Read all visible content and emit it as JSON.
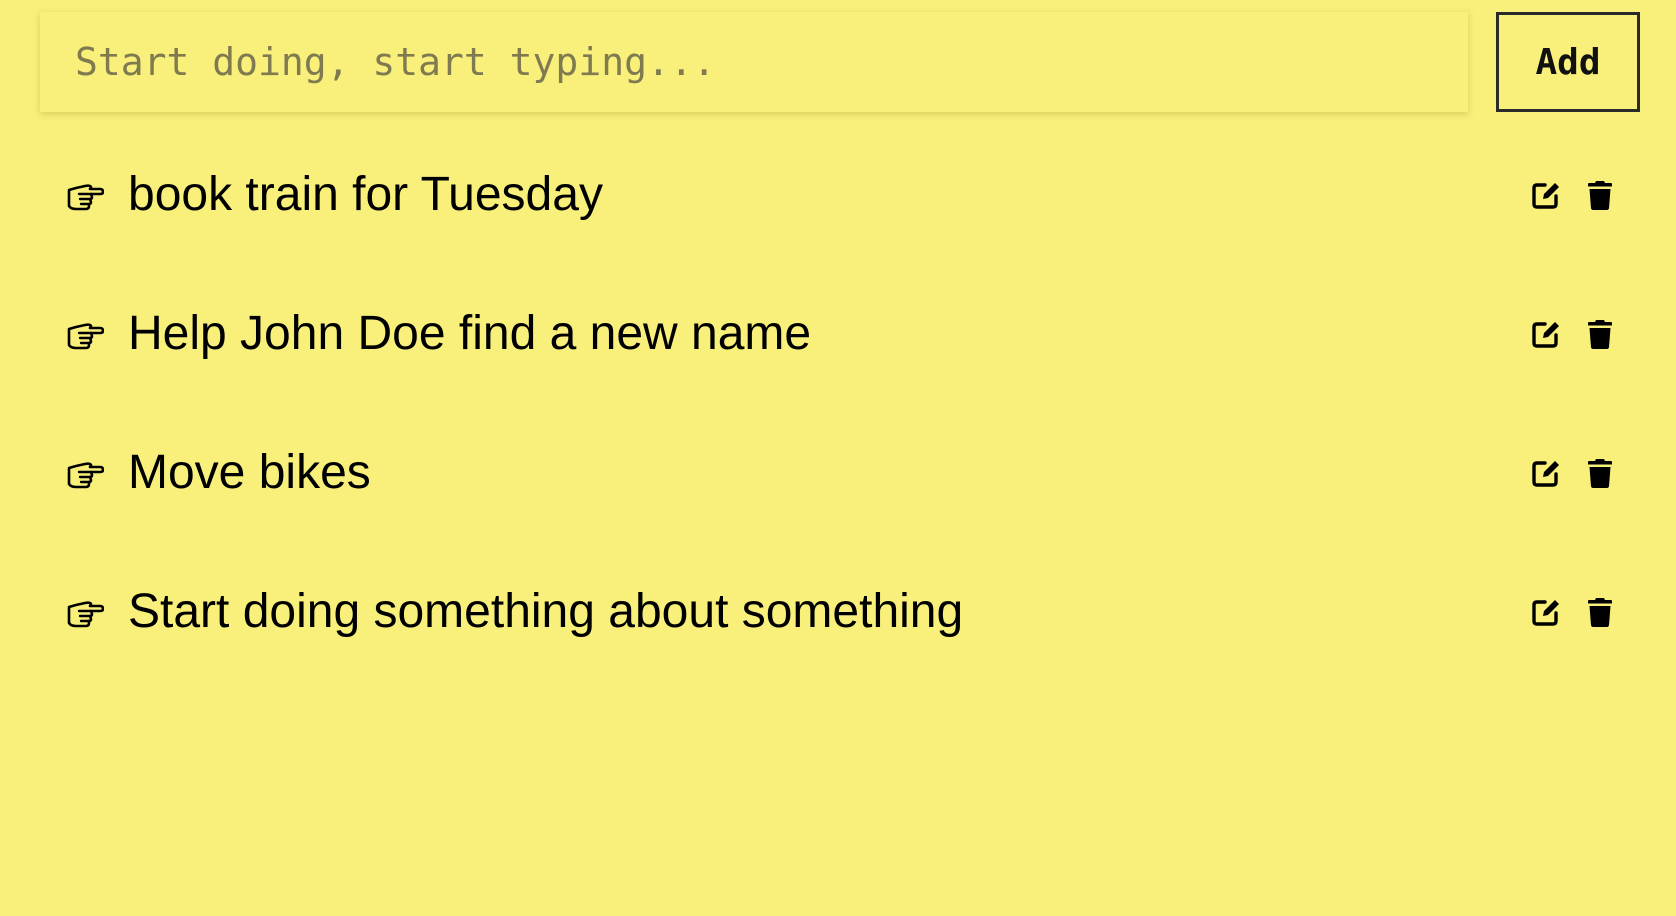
{
  "new_task": {
    "placeholder": "Start doing, start typing...",
    "value": "",
    "add_label": "Add"
  },
  "tasks": [
    {
      "text": "book train for Tuesday",
      "icon": "pointing-hand-icon"
    },
    {
      "text": "Help John Doe find a new name",
      "icon": "pointing-hand-icon"
    },
    {
      "text": "Move bikes",
      "icon": "pointing-hand-icon"
    },
    {
      "text": "Start doing something about something",
      "icon": "pointing-hand-icon"
    }
  ],
  "task_actions": {
    "edit_icon": "edit-icon",
    "delete_icon": "trash-icon"
  },
  "colors": {
    "background": "#f8f07a",
    "text": "#000000",
    "placeholder": "#7f7a50"
  }
}
